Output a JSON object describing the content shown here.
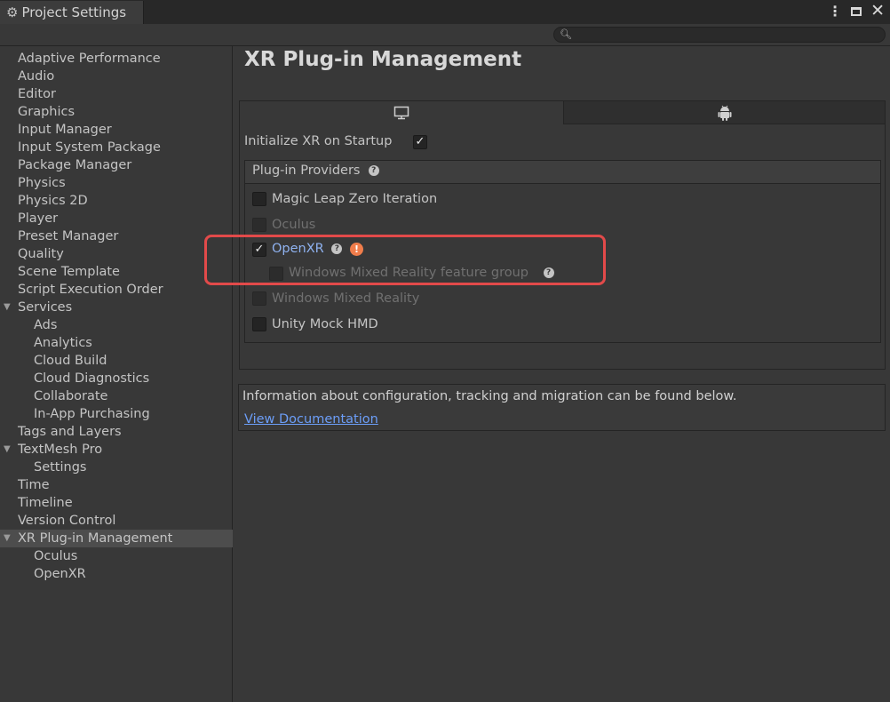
{
  "window": {
    "tab_title": "Project Settings",
    "icons": [
      "gear-icon",
      "kebab-menu-icon",
      "maximize-icon",
      "close-icon"
    ]
  },
  "search": {
    "placeholder": "",
    "icon": "search-icon"
  },
  "sidebar": {
    "items": [
      {
        "label": "Adaptive Performance",
        "indent": 0
      },
      {
        "label": "Audio",
        "indent": 0
      },
      {
        "label": "Editor",
        "indent": 0
      },
      {
        "label": "Graphics",
        "indent": 0
      },
      {
        "label": "Input Manager",
        "indent": 0
      },
      {
        "label": "Input System Package",
        "indent": 0
      },
      {
        "label": "Package Manager",
        "indent": 0
      },
      {
        "label": "Physics",
        "indent": 0
      },
      {
        "label": "Physics 2D",
        "indent": 0
      },
      {
        "label": "Player",
        "indent": 0
      },
      {
        "label": "Preset Manager",
        "indent": 0
      },
      {
        "label": "Quality",
        "indent": 0
      },
      {
        "label": "Scene Template",
        "indent": 0
      },
      {
        "label": "Script Execution Order",
        "indent": 0
      },
      {
        "label": "Services",
        "indent": 0,
        "expanded": true
      },
      {
        "label": "Ads",
        "indent": 1
      },
      {
        "label": "Analytics",
        "indent": 1
      },
      {
        "label": "Cloud Build",
        "indent": 1
      },
      {
        "label": "Cloud Diagnostics",
        "indent": 1
      },
      {
        "label": "Collaborate",
        "indent": 1
      },
      {
        "label": "In-App Purchasing",
        "indent": 1
      },
      {
        "label": "Tags and Layers",
        "indent": 0
      },
      {
        "label": "TextMesh Pro",
        "indent": 0,
        "expanded": true
      },
      {
        "label": "Settings",
        "indent": 1
      },
      {
        "label": "Time",
        "indent": 0
      },
      {
        "label": "Timeline",
        "indent": 0
      },
      {
        "label": "Version Control",
        "indent": 0
      },
      {
        "label": "XR Plug-in Management",
        "indent": 0,
        "expanded": true,
        "selected": true
      },
      {
        "label": "Oculus",
        "indent": 1
      },
      {
        "label": "OpenXR",
        "indent": 1
      }
    ]
  },
  "main": {
    "title": "XR Plug-in Management",
    "platform_tabs": [
      {
        "icon": "desktop-monitor-icon",
        "active": true
      },
      {
        "icon": "android-icon",
        "active": false
      }
    ],
    "init_xr_label": "Initialize XR on Startup",
    "init_xr_checked": true,
    "providers_header": "Plug-in Providers",
    "providers": [
      {
        "label": "Magic Leap Zero Iteration",
        "checked": false,
        "enabled": true
      },
      {
        "label": "Oculus",
        "checked": false,
        "enabled": false
      },
      {
        "label": "OpenXR",
        "checked": true,
        "enabled": true,
        "warning": true,
        "help": true
      },
      {
        "label": "Windows Mixed Reality feature group",
        "checked": false,
        "enabled": false,
        "help": true,
        "sub": true
      },
      {
        "label": "Windows Mixed Reality",
        "checked": false,
        "enabled": false
      },
      {
        "label": "Unity Mock HMD",
        "checked": false,
        "enabled": true
      }
    ],
    "info_text": "Information about configuration, tracking and migration can be found below.",
    "doc_link": "View Documentation"
  },
  "colors": {
    "background": "#383838",
    "selected_row": "#4d4d4d",
    "link": "#6c9ef8",
    "warning": "#f07d4b",
    "highlight_box": "#e24a4a"
  }
}
